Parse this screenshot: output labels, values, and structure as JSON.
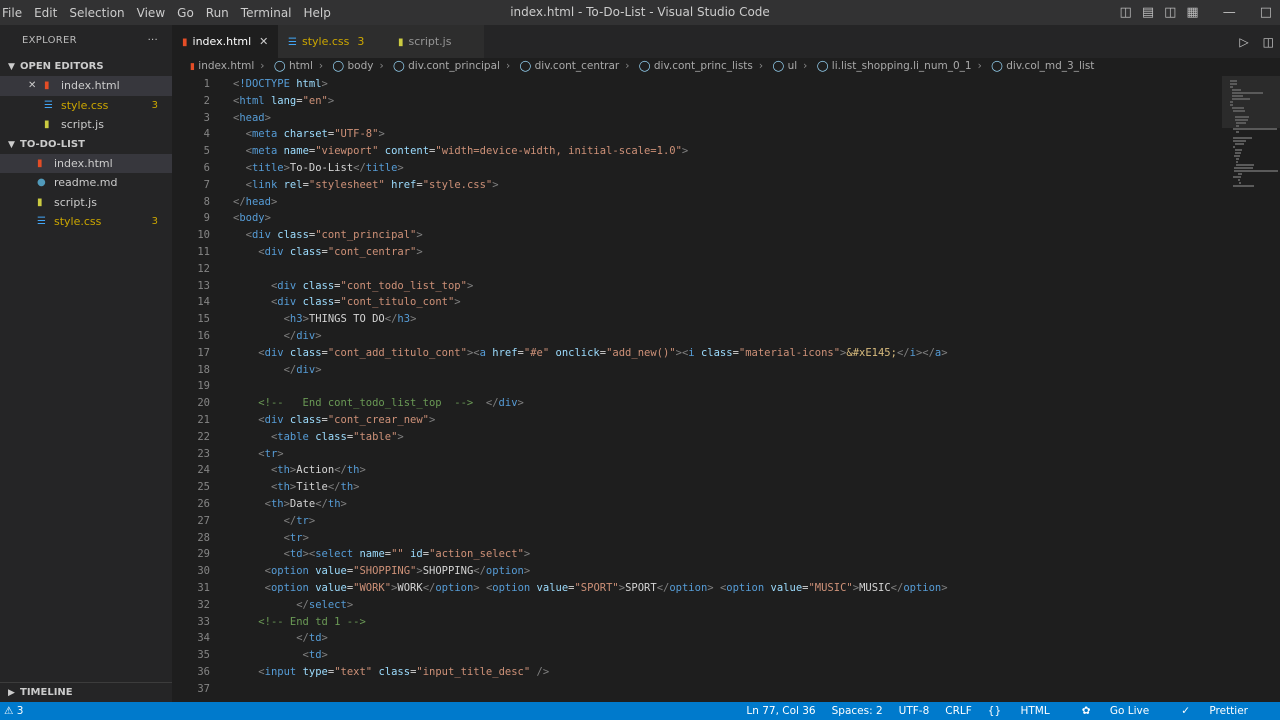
{
  "window": {
    "menu": [
      "File",
      "Edit",
      "Selection",
      "View",
      "Go",
      "Run",
      "Terminal",
      "Help"
    ],
    "title": "index.html - To-Do-List - Visual Studio Code"
  },
  "sidebar": {
    "header": "EXPLORER",
    "open_editors_title": "OPEN EDITORS",
    "open_editors": [
      {
        "name": "index.html",
        "icon": "html-file-icon",
        "badge": ""
      },
      {
        "name": "style.css",
        "icon": "css-file-icon",
        "badge": "3"
      },
      {
        "name": "script.js",
        "icon": "js-file-icon",
        "badge": ""
      }
    ],
    "project_title": "TO-DO-LIST",
    "files": [
      {
        "name": "index.html",
        "icon": "html-file-icon",
        "badge": ""
      },
      {
        "name": "readme.md",
        "icon": "info-file-icon",
        "badge": ""
      },
      {
        "name": "script.js",
        "icon": "js-file-icon",
        "badge": ""
      },
      {
        "name": "style.css",
        "icon": "css-file-icon",
        "badge": "3"
      }
    ],
    "timeline": "TIMELINE"
  },
  "tabs": [
    {
      "label": "index.html",
      "icon": "html-file-icon",
      "badge": ""
    },
    {
      "label": "style.css",
      "icon": "css-file-icon",
      "badge": "3"
    },
    {
      "label": "script.js",
      "icon": "js-file-icon",
      "badge": ""
    }
  ],
  "breadcrumb": [
    "index.html",
    "html",
    "body",
    "div.cont_principal",
    "div.cont_centrar",
    "div.cont_princ_lists",
    "ul",
    "li.list_shopping.li_num_0_1",
    "div.col_md_3_list"
  ],
  "code_lines": [
    "<!DOCTYPE html>",
    "<html lang=\"en\">",
    "<head>",
    "  <meta charset=\"UTF-8\">",
    "  <meta name=\"viewport\" content=\"width=device-width, initial-scale=1.0\">",
    "  <title>To-Do-List</title>",
    "  <link rel=\"stylesheet\" href=\"style.css\">",
    "</head>",
    "<body>",
    "  <div class=\"cont_principal\">",
    "    <div class=\"cont_centrar\">",
    "",
    "      <div class=\"cont_todo_list_top\">",
    "      <div class=\"cont_titulo_cont\">",
    "        <h3>THINGS TO DO</h3>",
    "        </div>",
    "    <div class=\"cont_add_titulo_cont\"><a href=\"#e\" onclick=\"add_new()\"><i class=\"material-icons\">&#xE145;</i></a>",
    "        </div>",
    "",
    "    <!--   End cont_todo_list_top  -->  </div>",
    "    <div class=\"cont_crear_new\">",
    "      <table class=\"table\">",
    "    <tr>",
    "      <th>Action</th>",
    "      <th>Title</th>",
    "     <th>Date</th>",
    "        </tr>",
    "        <tr>",
    "        <td><select name=\"\" id=\"action_select\">",
    "     <option value=\"SHOPPING\">SHOPPING</option>",
    "     <option value=\"WORK\">WORK</option> <option value=\"SPORT\">SPORT</option> <option value=\"MUSIC\">MUSIC</option>",
    "          </select>",
    "    <!-- End td 1 -->",
    "          </td>",
    "           <td>",
    "    <input type=\"text\" class=\"input_title_desc\" />",
    ""
  ],
  "status": {
    "warnings": "3",
    "position": "Ln 77, Col 36",
    "spaces": "Spaces: 2",
    "encoding": "UTF-8",
    "eol": "CRLF",
    "language": "HTML",
    "golive": "Go Live",
    "prettier": "Prettier"
  },
  "colors": {
    "status_bar": "#007acc",
    "editor_bg": "#1e1e1e",
    "sidebar_bg": "#252526",
    "warning": "#cca700"
  }
}
